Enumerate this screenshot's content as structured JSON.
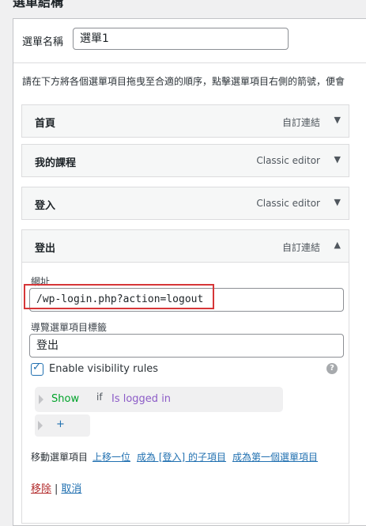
{
  "section": {
    "title": "選單結構"
  },
  "menu_name": {
    "label": "選單名稱",
    "value": "選單1"
  },
  "instructions": "請在下方將各個選單項目拖曳至合適的順序，點擊選單項目右側的箭號，便會",
  "items": [
    {
      "title": "首頁",
      "type": "自訂連結",
      "toggle": "▼"
    },
    {
      "title": "我的課程",
      "type": "Classic editor",
      "toggle": "▼"
    },
    {
      "title": "登入",
      "type": "Classic editor",
      "toggle": "▼"
    },
    {
      "title": "登出",
      "type": "自訂連結",
      "toggle": "▲"
    }
  ],
  "expanded_item": {
    "url_label": "網址",
    "url_value": "/wp-login.php?action=logout",
    "nav_label": "導覽選單項目標籤",
    "nav_value": "登出",
    "visibility_label": "Enable visibility rules",
    "help": "?",
    "rule": {
      "action": "Show",
      "keyword": "if",
      "condition": "Is logged in"
    },
    "add_rule": "+",
    "move": {
      "label": "移動選單項目",
      "up": "上移一位",
      "child_of": "成為 [登入] 的子項目",
      "first": "成為第一個選單項目"
    },
    "delete": "移除",
    "separator": "|",
    "cancel": "取消"
  },
  "colors": {
    "highlight_border": "#d63638",
    "link": "#2271b1",
    "delete": "#b32d2e"
  }
}
